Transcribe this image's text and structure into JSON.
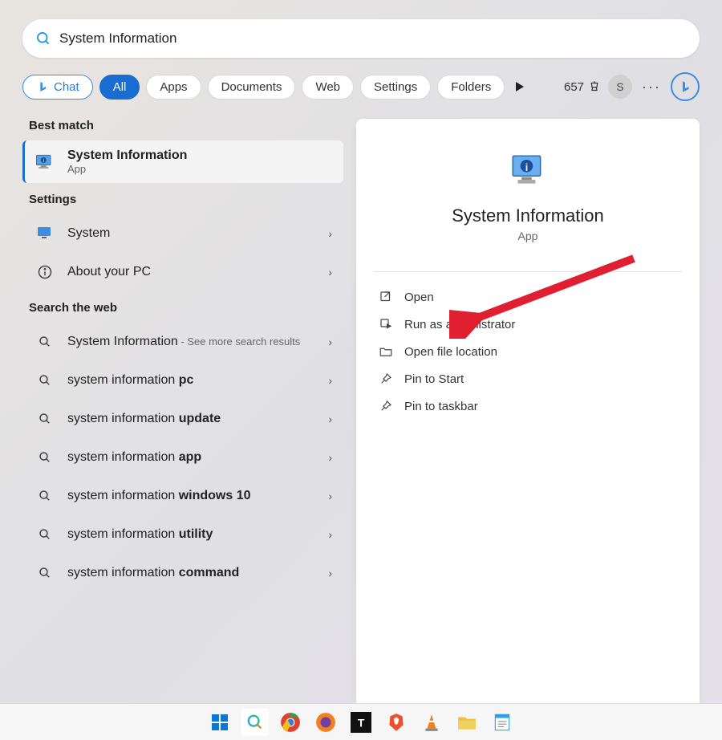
{
  "search": {
    "query": "System Information"
  },
  "filters": {
    "chat": "Chat",
    "all": "All",
    "apps": "Apps",
    "documents": "Documents",
    "web": "Web",
    "settings": "Settings",
    "folders": "Folders"
  },
  "header": {
    "points": "657",
    "avatar_initial": "S"
  },
  "left": {
    "best_match_header": "Best match",
    "best_match": {
      "title": "System Information",
      "subtitle": "App"
    },
    "settings_header": "Settings",
    "settings_items": [
      {
        "label": "System"
      },
      {
        "label": "About your PC"
      }
    ],
    "web_header": "Search the web",
    "web_items": [
      {
        "prefix": "System Information",
        "suffix": " - See more search results"
      },
      {
        "prefix": "system information ",
        "suffix": "pc"
      },
      {
        "prefix": "system information ",
        "suffix": "update"
      },
      {
        "prefix": "system information ",
        "suffix": "app"
      },
      {
        "prefix": "system information ",
        "suffix": "windows 10"
      },
      {
        "prefix": "system information ",
        "suffix": "utility"
      },
      {
        "prefix": "system information ",
        "suffix": "command"
      }
    ]
  },
  "detail": {
    "title": "System Information",
    "subtitle": "App",
    "actions": [
      {
        "icon": "open-icon",
        "label": "Open"
      },
      {
        "icon": "admin-icon",
        "label": "Run as administrator"
      },
      {
        "icon": "folder-icon",
        "label": "Open file location"
      },
      {
        "icon": "pin-icon",
        "label": "Pin to Start"
      },
      {
        "icon": "pin-icon",
        "label": "Pin to taskbar"
      }
    ]
  }
}
